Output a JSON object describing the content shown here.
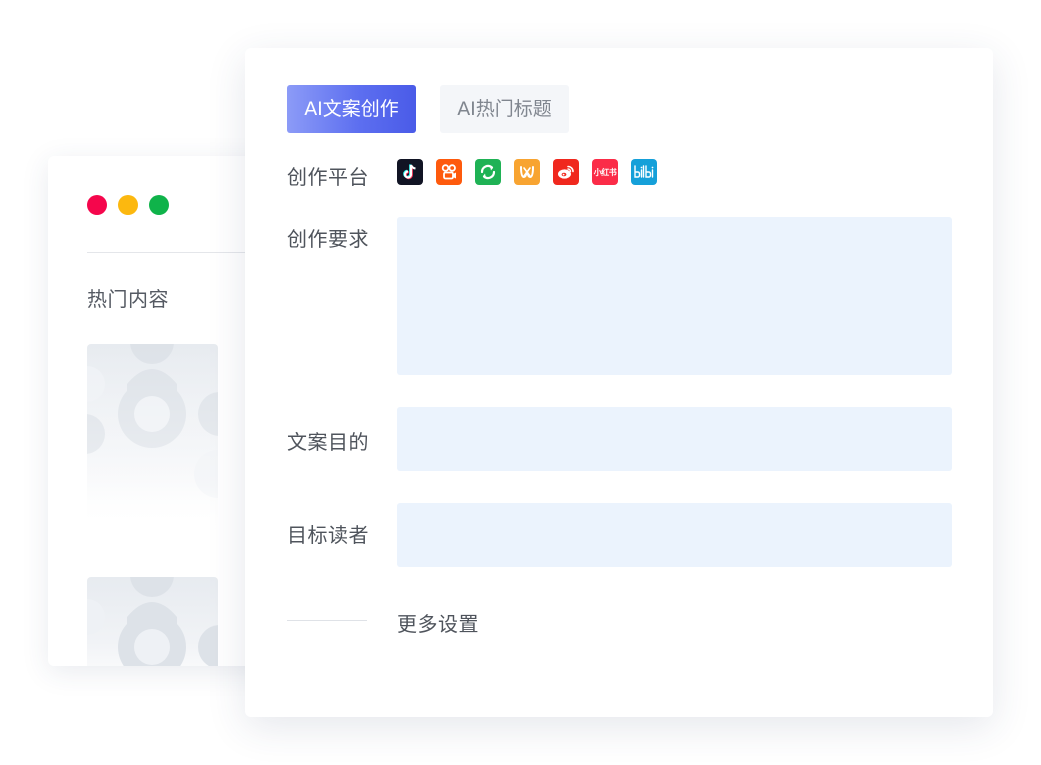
{
  "window_controls": {
    "colors": [
      "#f5064c",
      "#fcb80f",
      "#0fb34a"
    ]
  },
  "back_panel": {
    "title": "热门内容"
  },
  "tabs": [
    {
      "label": "AI文案创作",
      "active": true
    },
    {
      "label": "AI热门标题",
      "active": false
    }
  ],
  "form": {
    "platform_label": "创作平台",
    "platforms": [
      {
        "icon": "douyin-icon",
        "color": "#111424"
      },
      {
        "icon": "kuaishou-icon",
        "color": "#fe5a0d"
      },
      {
        "icon": "wechat-channels-icon",
        "color": "#1fb255"
      },
      {
        "icon": "miaopai-icon",
        "color": "#f8a431"
      },
      {
        "icon": "weibo-icon",
        "color": "#f0281e"
      },
      {
        "icon": "xiaohongshu-icon",
        "color": "#fb2c48",
        "text": "小红书"
      },
      {
        "icon": "bilibili-icon",
        "color": "#15a0d9",
        "text": "bilibili"
      }
    ],
    "requirement_label": "创作要求",
    "requirement_value": "",
    "purpose_label": "文案目的",
    "purpose_value": "",
    "audience_label": "目标读者",
    "audience_value": "",
    "more_settings": "更多设置"
  },
  "colors": {
    "accent_start": "#8c9bf7",
    "accent_end": "#4a5be8",
    "field_bg": "#ebf3fd"
  }
}
